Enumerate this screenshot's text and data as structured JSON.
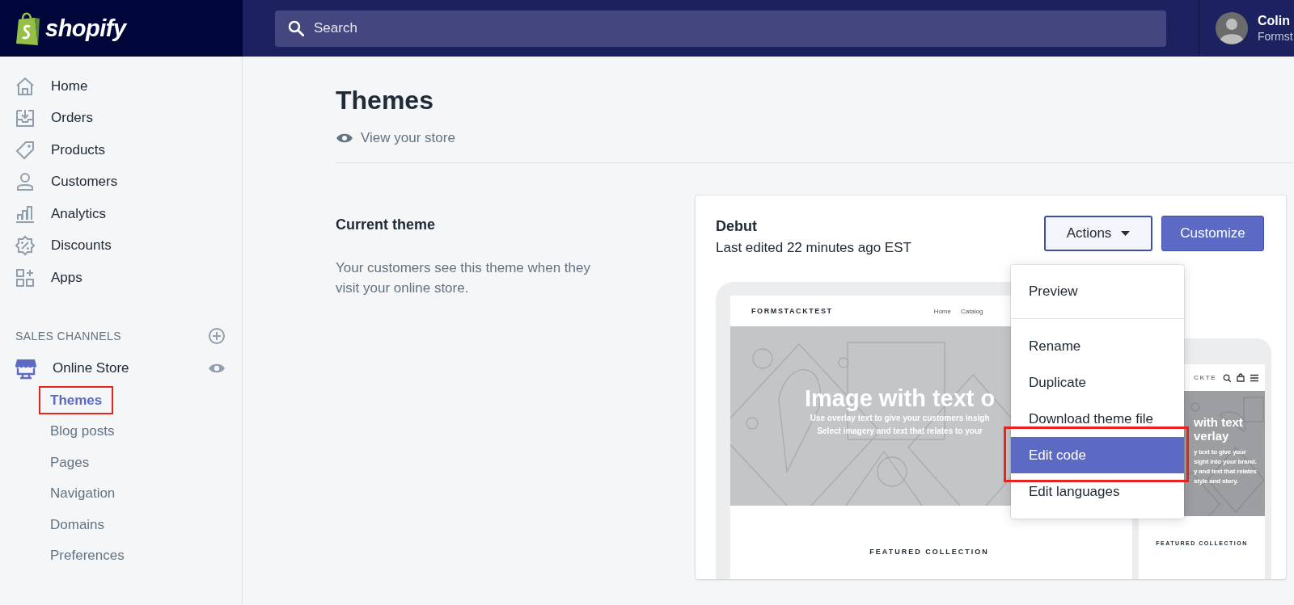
{
  "header": {
    "logo": "shopify",
    "search": {
      "placeholder": "Search"
    },
    "user": {
      "name": "Colin",
      "store": "Formst"
    }
  },
  "sidebar": {
    "items": [
      {
        "label": "Home"
      },
      {
        "label": "Orders"
      },
      {
        "label": "Products"
      },
      {
        "label": "Customers"
      },
      {
        "label": "Analytics"
      },
      {
        "label": "Discounts"
      },
      {
        "label": "Apps"
      }
    ],
    "section_title": "SALES CHANNELS",
    "channel": {
      "label": "Online Store",
      "children": [
        {
          "label": "Themes",
          "selected": true,
          "annotated": true
        },
        {
          "label": "Blog posts",
          "selected": false,
          "annotated": false
        },
        {
          "label": "Pages",
          "selected": false,
          "annotated": false
        },
        {
          "label": "Navigation",
          "selected": false,
          "annotated": false
        },
        {
          "label": "Domains",
          "selected": false,
          "annotated": false
        },
        {
          "label": "Preferences",
          "selected": false,
          "annotated": false
        }
      ]
    }
  },
  "page": {
    "title": "Themes",
    "view_link": "View your store"
  },
  "current_theme": {
    "heading": "Current theme",
    "description": "Your customers see this theme when they visit your online store."
  },
  "theme": {
    "name": "Debut",
    "edited": "Last edited 22 minutes ago EST",
    "actions": {
      "label": "Actions",
      "expanded": true
    },
    "customize": "Customize",
    "menu": [
      [
        {
          "label": "Preview",
          "selected": false,
          "annotated": false
        }
      ],
      [
        {
          "label": "Rename",
          "selected": false,
          "annotated": false
        },
        {
          "label": "Duplicate",
          "selected": false,
          "annotated": false
        },
        {
          "label": "Download theme file",
          "selected": false,
          "annotated": false
        },
        {
          "label": "Edit code",
          "selected": true,
          "annotated": true
        },
        {
          "label": "Edit languages",
          "selected": false,
          "annotated": false
        }
      ]
    ]
  },
  "desktop_preview": {
    "store_name": "FORMSTACKTEST",
    "nav": [
      "Home",
      "Catalog"
    ],
    "hero_title": "Image with text o",
    "hero_lines": [
      "Use overlay text to give your customers insigh",
      "Select imagery and text that relates to your"
    ],
    "featured": "FEATURED COLLECTION"
  },
  "mobile_preview": {
    "store_name": "CKTE",
    "hero_title": [
      "with text",
      "verlay"
    ],
    "hero_lines": [
      "y text to give your",
      "sight into your brand.",
      "y and text that relates",
      "style and story."
    ],
    "featured": "FEATURED COLLECTION"
  }
}
